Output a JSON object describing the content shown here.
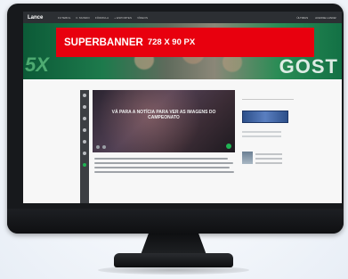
{
  "banner": {
    "title": "SUPERBANNER",
    "size": "728 X 90 PX"
  },
  "site": {
    "logo": "Lance",
    "nav": [
      "FUTEBOL",
      "F. MUNDO",
      "FÓRMULA",
      "+ ESPORTES",
      "VÍDEOS"
    ],
    "nav_right": [
      "ÚLTIMAS",
      "ACESSE LANCE!"
    ]
  },
  "hero": {
    "left_text": "5X",
    "right_text": "GOST"
  },
  "article": {
    "title": "VÁ PARA A NOTÍCIA PARA VER AS IMAGENS DO CAMPEONATO"
  },
  "colors": {
    "banner": "#e8000e",
    "accent": "#20b454",
    "monitor": "#17191c"
  }
}
